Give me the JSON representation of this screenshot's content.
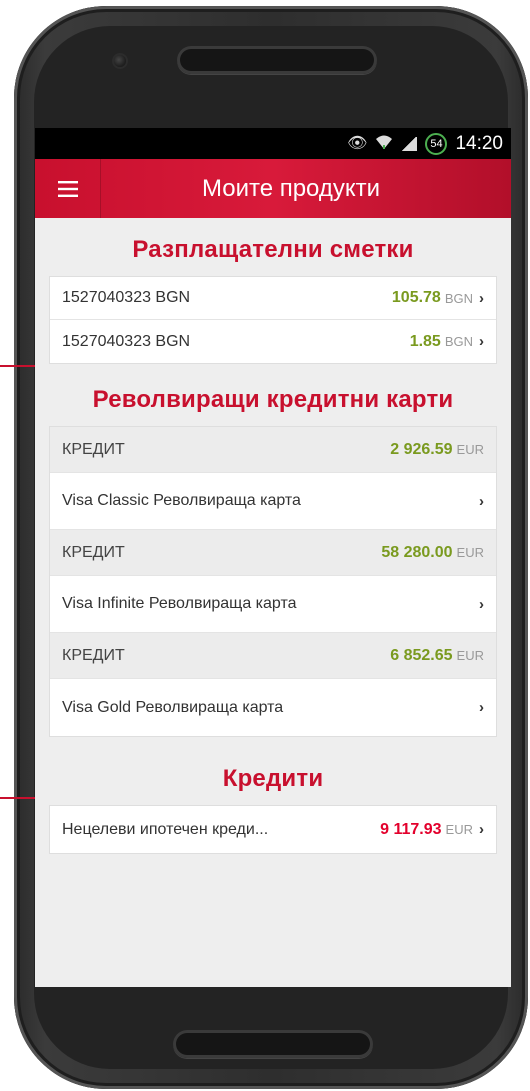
{
  "statusbar": {
    "icons": [
      "eye-icon",
      "wifi-icon",
      "signal-icon"
    ],
    "battery": "54",
    "time": "14:20"
  },
  "appbar": {
    "menu_icon": "hamburger-icon",
    "title": "Моите продукти"
  },
  "sections": {
    "accounts": {
      "title": "Разплащателни сметки",
      "rows": [
        {
          "label": "1527040323 BGN",
          "amount": "105.78",
          "currency": "BGN",
          "chevron": "›"
        },
        {
          "label": "1527040323 BGN",
          "amount": "1.85",
          "currency": "BGN",
          "chevron": "›"
        }
      ]
    },
    "cards": {
      "title": "Револвиращи кредитни карти",
      "rows": [
        {
          "label": "КРЕДИТ",
          "amount": "2 926.59",
          "currency": "EUR"
        },
        {
          "label": "Visa Classic Револвираща карта",
          "chevron": "›"
        },
        {
          "label": "КРЕДИТ",
          "amount": "58 280.00",
          "currency": "EUR"
        },
        {
          "label": "Visa Infinite Револвираща карта",
          "chevron": "›"
        },
        {
          "label": "КРЕДИТ",
          "amount": "6 852.65",
          "currency": "EUR"
        },
        {
          "label": "Visa Gold Револвираща карта",
          "chevron": "›"
        }
      ]
    },
    "loans": {
      "title": "Кредити",
      "rows": [
        {
          "label": "Нецелеви ипотечен креди...",
          "amount": "9 117.93",
          "currency": "EUR",
          "chevron": "›"
        }
      ]
    }
  },
  "colors": {
    "brand": "#c8102e",
    "positive_amount": "#7a9a1f",
    "negative_amount": "#e3002c"
  }
}
